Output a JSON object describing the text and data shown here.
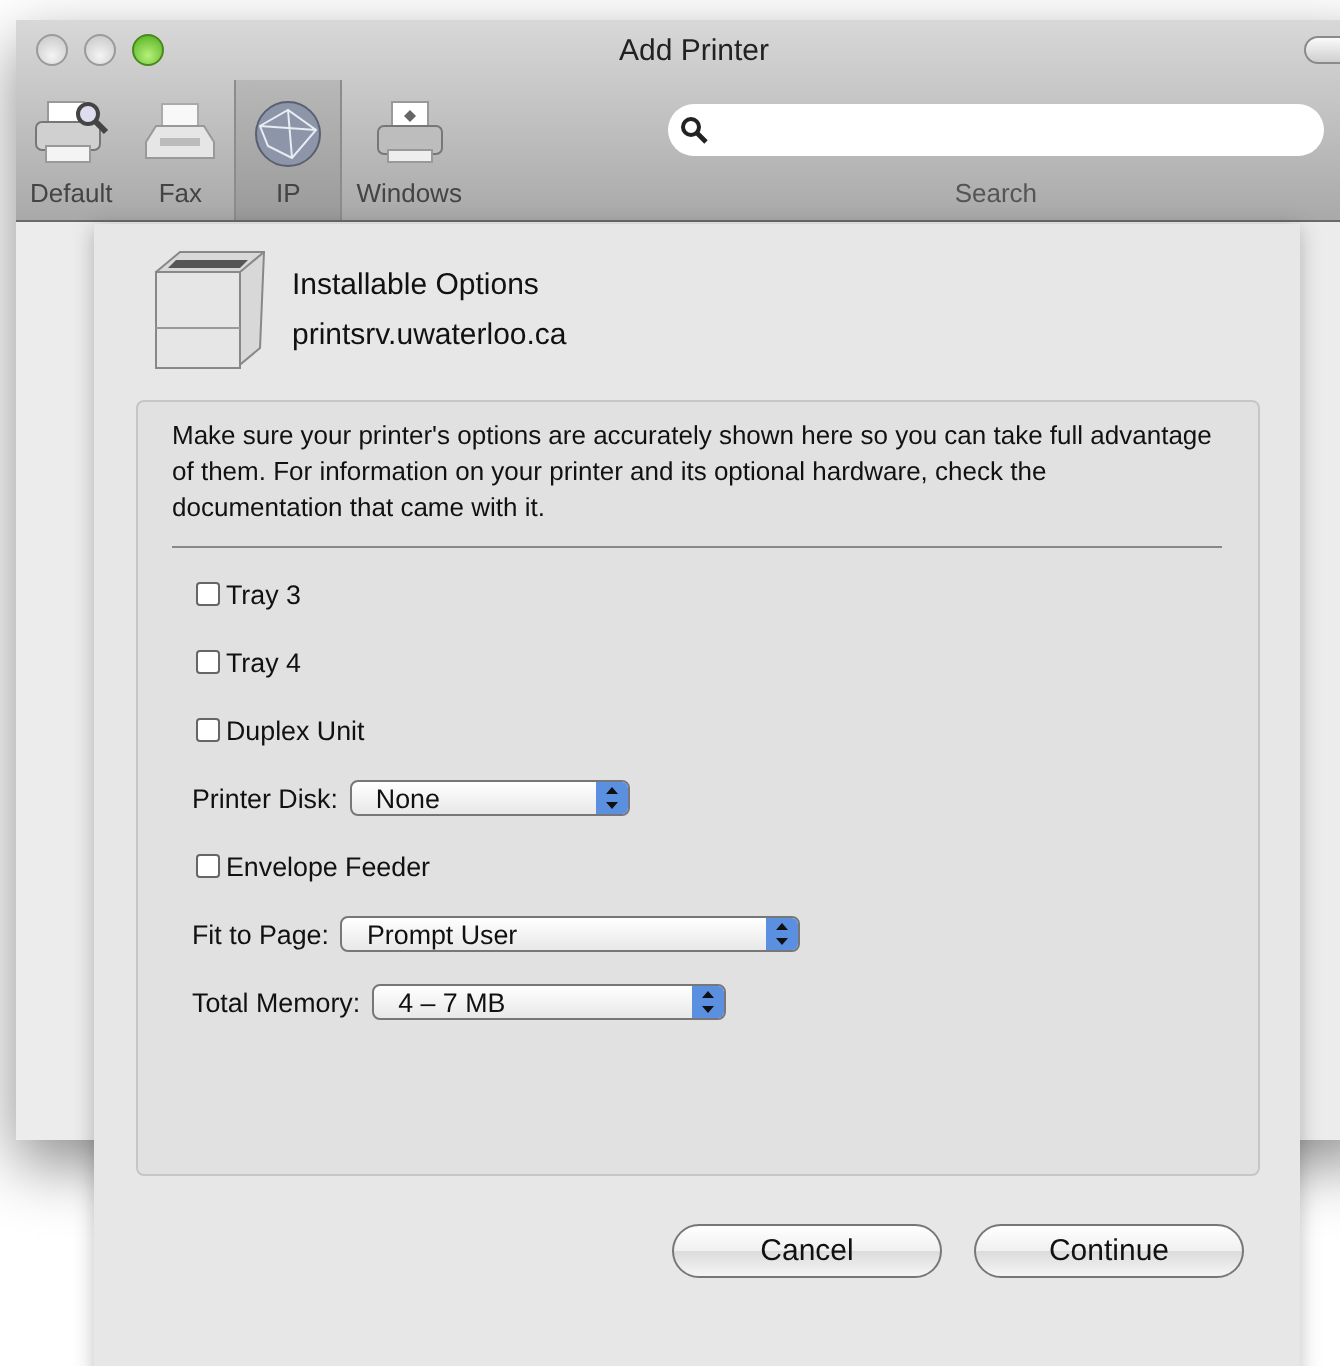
{
  "window": {
    "title": "Add Printer"
  },
  "toolbar": {
    "items": [
      {
        "label": "Default",
        "kind": "printer-search",
        "selected": false
      },
      {
        "label": "Fax",
        "kind": "fax",
        "selected": false
      },
      {
        "label": "IP",
        "kind": "globe",
        "selected": true
      },
      {
        "label": "Windows",
        "kind": "printer",
        "selected": false
      }
    ],
    "search": {
      "label": "Search"
    }
  },
  "sheet": {
    "title": "Installable Options",
    "subtitle": "printsrv.uwaterloo.ca",
    "description": "Make sure your printer's options are accurately shown here so you can take full advantage of them.  For information on your printer and its optional hardware, check the documentation that came with it.",
    "options": [
      {
        "kind": "checkbox",
        "label": "Tray 3",
        "checked": false
      },
      {
        "kind": "checkbox",
        "label": "Tray 4",
        "checked": false
      },
      {
        "kind": "checkbox",
        "label": "Duplex Unit",
        "checked": false
      },
      {
        "kind": "popup",
        "label": "Printer Disk:",
        "value": "None"
      },
      {
        "kind": "checkbox",
        "label": "Envelope Feeder",
        "checked": false
      },
      {
        "kind": "popup",
        "label": "Fit to Page:",
        "value": "Prompt User"
      },
      {
        "kind": "popup",
        "label": "Total Memory:",
        "value": "4 – 7 MB"
      }
    ],
    "buttons": [
      "Cancel",
      "Continue"
    ]
  }
}
